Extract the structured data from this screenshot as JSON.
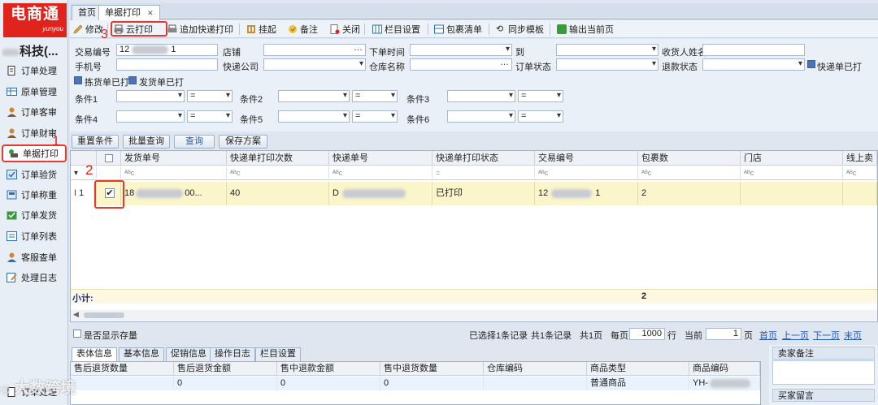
{
  "app": {
    "logo_text": "电商通",
    "logo_sub": "yunyou",
    "company": "科技(..."
  },
  "sidebar": {
    "items": [
      {
        "label": "订单处理",
        "icon": "doc-icon"
      },
      {
        "label": "原单管理",
        "icon": "table-icon"
      },
      {
        "label": "订单客审",
        "icon": "user-icon"
      },
      {
        "label": "订单财审",
        "icon": "user-icon"
      },
      {
        "label": "单据打印",
        "icon": "print-icon"
      },
      {
        "label": "订单验货",
        "icon": "check-icon"
      },
      {
        "label": "订单称重",
        "icon": "scale-icon"
      },
      {
        "label": "订单发货",
        "icon": "ship-icon"
      },
      {
        "label": "订单列表",
        "icon": "list-icon"
      },
      {
        "label": "客服查单",
        "icon": "user-icon"
      },
      {
        "label": "处理日志",
        "icon": "log-icon"
      }
    ],
    "bottom_item": "订单处理"
  },
  "annotations": {
    "n1": "1",
    "n2": "2",
    "n3": "3"
  },
  "tabs": [
    {
      "label": "首页"
    },
    {
      "label": "单据打印",
      "close": "✕"
    }
  ],
  "toolbar": {
    "items": [
      "修改",
      "云打印",
      "追加快递打印",
      "挂起",
      "备注",
      "关闭",
      "栏目设置",
      "包裹清单",
      "同步模板",
      "输出当前页"
    ]
  },
  "filters": {
    "trade_no_label": "交易编号",
    "trade_no_prefix": "12",
    "trade_no_suffix": "1",
    "shop_label": "店铺",
    "order_time_label": "下单时间",
    "to_label": "到",
    "receiver_label": "收货人姓名",
    "phone_label": "手机号",
    "express_label": "快递公司",
    "warehouse_label": "仓库名称",
    "order_status_label": "订单状态",
    "refund_label": "退款状态",
    "express_printed_label": "快递单已打",
    "pick_printed_label": "拣货单已打",
    "ship_printed_label": "发货单已打",
    "cond1": "条件1",
    "cond2": "条件2",
    "cond3": "条件3",
    "cond4": "条件4",
    "cond5": "条件5",
    "cond6": "条件6",
    "eq": "="
  },
  "actions": {
    "reset": "重置条件",
    "batch": "批量查询",
    "query": "查询",
    "save": "保存方案"
  },
  "grid": {
    "columns": [
      "发货单号",
      "快递单打印次数",
      "快递单号",
      "快递单打印状态",
      "交易编号",
      "包裹数",
      "门店",
      "线上卖"
    ],
    "filter_placeholder": "ᴬᴮc",
    "filter_eq": "=",
    "rows": [
      {
        "row_no": "1",
        "checked": true,
        "ship_no_prefix": "18",
        "ship_no_suffix": "00...",
        "print_count": "40",
        "express_no_prefix": "D",
        "print_status": "已打印",
        "trade_no_prefix": "12",
        "trade_no_suffix": "1",
        "packages": "2"
      }
    ],
    "subtotal_label": "小计:",
    "subtotal_packages": "2"
  },
  "pager": {
    "show_stock": "是否显示存量",
    "selected": "已选择1条记录",
    "total": "共1条记录",
    "pages": "共1页",
    "per_page_label": "每页",
    "per_page": "1000",
    "row_unit": "行",
    "current_label": "当前",
    "current": "1",
    "page_unit": "页",
    "first": "首页",
    "prev": "上一页",
    "next": "下一页",
    "last": "末页"
  },
  "bottom_tabs": [
    "表体信息",
    "基本信息",
    "促销信息",
    "操作日志",
    "栏目设置"
  ],
  "detail": {
    "columns": [
      "售后退货数量",
      "售后退货金额",
      "售中退款金额",
      "售中退货数量",
      "仓库编码",
      "商品类型",
      "商品编码"
    ],
    "row": [
      "",
      "0",
      "0",
      "0",
      "",
      "普通商品",
      "YH-"
    ]
  },
  "right_panel": {
    "seller_note": "卖家备注",
    "buyer_msg": "买家留言"
  },
  "watermark": "大数跨境"
}
